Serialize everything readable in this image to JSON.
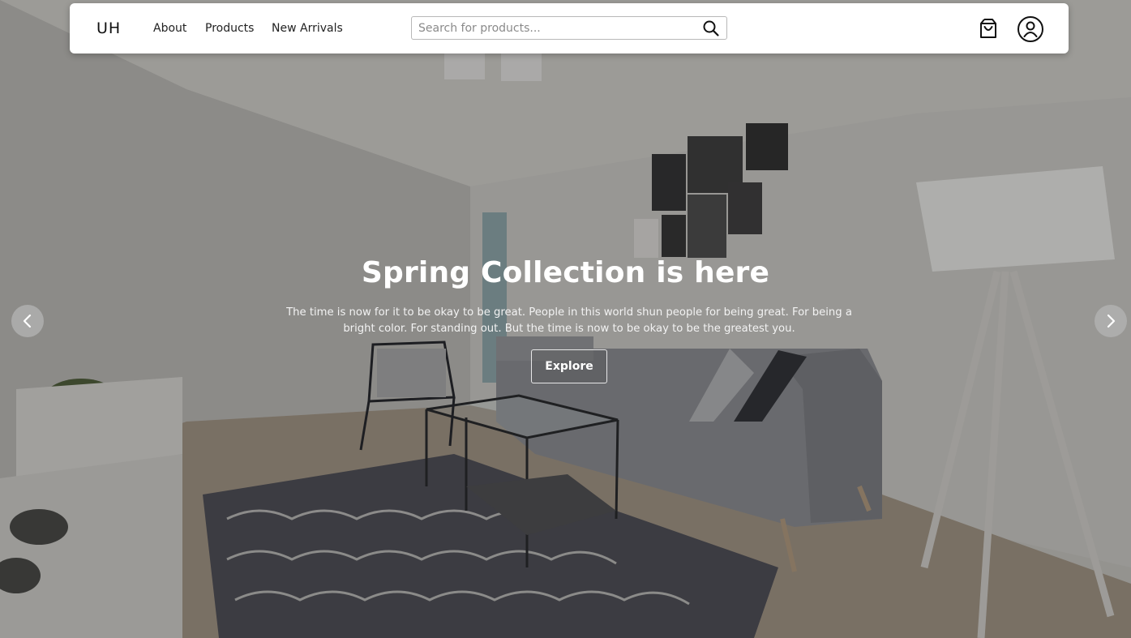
{
  "navbar": {
    "logo": "UH",
    "links": [
      "About",
      "Products",
      "New Arrivals"
    ],
    "search_placeholder": "Search for products...",
    "icons": {
      "search": "search-icon",
      "cart": "shopping-bag-icon",
      "account": "user-circle-icon"
    }
  },
  "hero": {
    "title": "Spring Collection is here",
    "description": "The time is now for it to be okay to be great. People in this world shun people for being great. For being a bright color. For standing out. But the time is now to be okay to be the greatest you.",
    "cta_label": "Explore",
    "icons": {
      "prev": "chevron-left-icon",
      "next": "chevron-right-icon"
    }
  },
  "colors": {
    "navbar_bg": "#ffffff",
    "hero_text": "#ffffff",
    "arrow_bg": "#b4b4b4"
  }
}
